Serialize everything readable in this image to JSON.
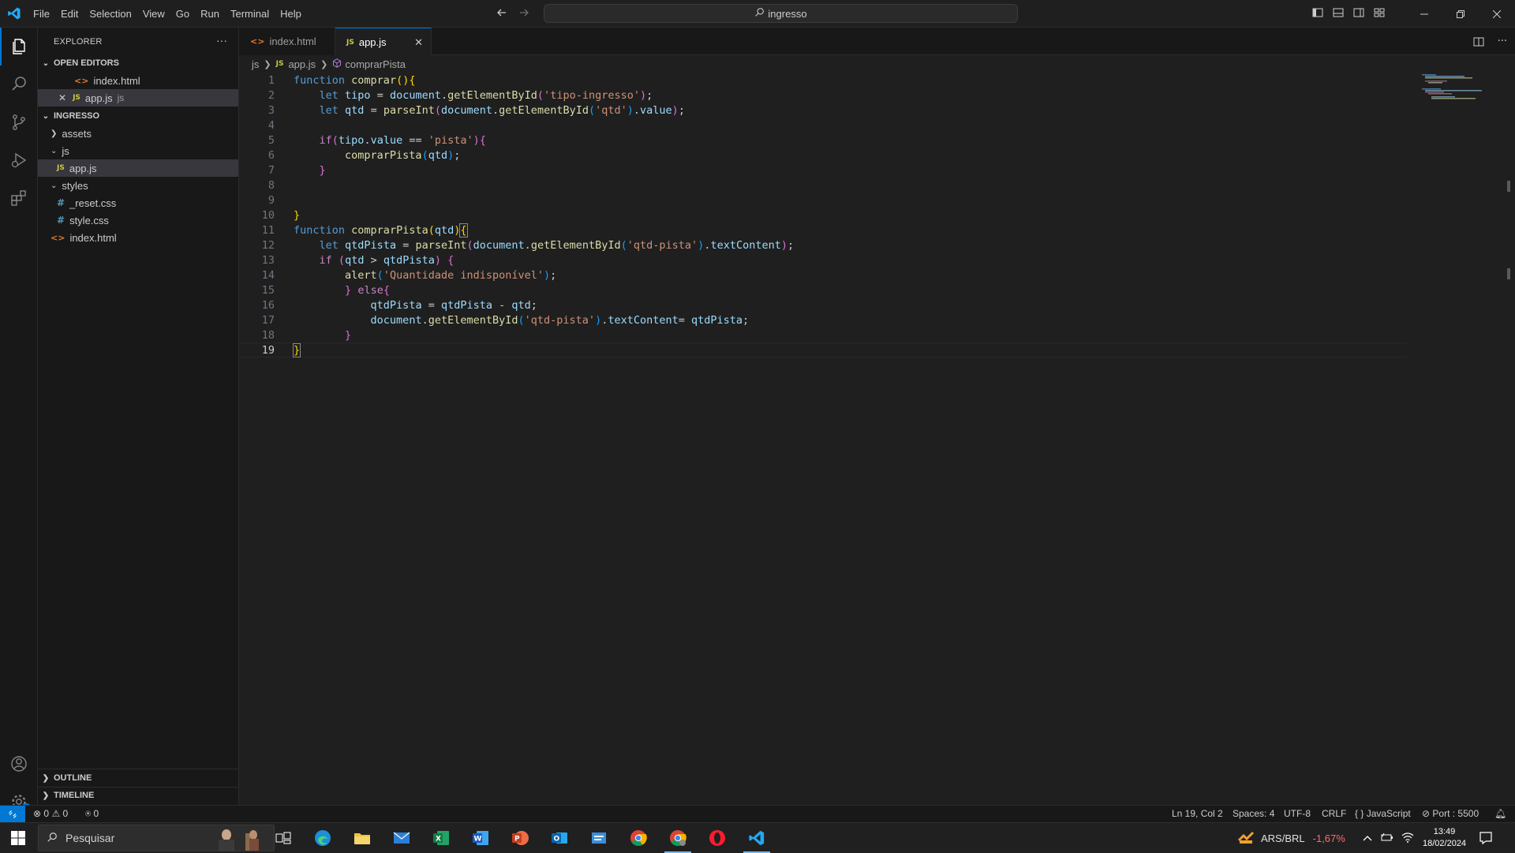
{
  "menu": [
    "File",
    "Edit",
    "Selection",
    "View",
    "Go",
    "Run",
    "Terminal",
    "Help"
  ],
  "search": {
    "text": "ingresso"
  },
  "explorer": {
    "title": "EXPLORER",
    "open_editors_label": "OPEN EDITORS",
    "open_editors": [
      {
        "name": "index.html",
        "type": "html"
      },
      {
        "name": "app.js",
        "type": "js",
        "folder": "js"
      }
    ],
    "workspace_label": "INGRESSO",
    "tree": [
      {
        "name": "assets",
        "kind": "folder",
        "expanded": false
      },
      {
        "name": "js",
        "kind": "folder",
        "expanded": true
      },
      {
        "name": "app.js",
        "kind": "js"
      },
      {
        "name": "styles",
        "kind": "folder",
        "expanded": true
      },
      {
        "name": "_reset.css",
        "kind": "css"
      },
      {
        "name": "style.css",
        "kind": "css"
      },
      {
        "name": "index.html",
        "kind": "html"
      }
    ],
    "outline_label": "OUTLINE",
    "timeline_label": "TIMELINE"
  },
  "tabs": [
    {
      "label": "index.html",
      "active": false
    },
    {
      "label": "app.js",
      "active": true
    }
  ],
  "breadcrumb": {
    "folder": "js",
    "file": "app.js",
    "symbol": "comprarPista"
  },
  "code_lines": [
    "function comprar(){",
    "    let tipo = document.getElementById('tipo-ingresso');",
    "    let qtd = parseInt(document.getElementById('qtd').value);",
    "",
    "    if(tipo.value == 'pista'){",
    "        comprarPista(qtd);",
    "    }",
    "",
    "",
    "}",
    "function comprarPista(qtd){",
    "    let qtdPista = parseInt(document.getElementById('qtd-pista').textContent);",
    "    if (qtd > qtdPista) {",
    "        alert('Quantidade indisponível');",
    "        } else{",
    "            qtdPista = qtdPista - qtd;",
    "            document.getElementById('qtd-pista').textContent= qtdPista;",
    "        }",
    "}"
  ],
  "current_line": 19,
  "status": {
    "errors": "0",
    "warnings": "0",
    "ports": "0",
    "position": "Ln 19, Col 2",
    "spaces": "Spaces: 4",
    "encoding": "UTF-8",
    "eol": "CRLF",
    "language": "JavaScript",
    "port": "Port : 5500"
  },
  "taskbar": {
    "search_placeholder": "Pesquisar",
    "currency": "ARS/BRL",
    "currency_change": "-1,67%",
    "time": "13:49",
    "date": "18/02/2024"
  },
  "colors": {
    "accent": "#0078d4",
    "currency_change": "#ff6b6b"
  }
}
